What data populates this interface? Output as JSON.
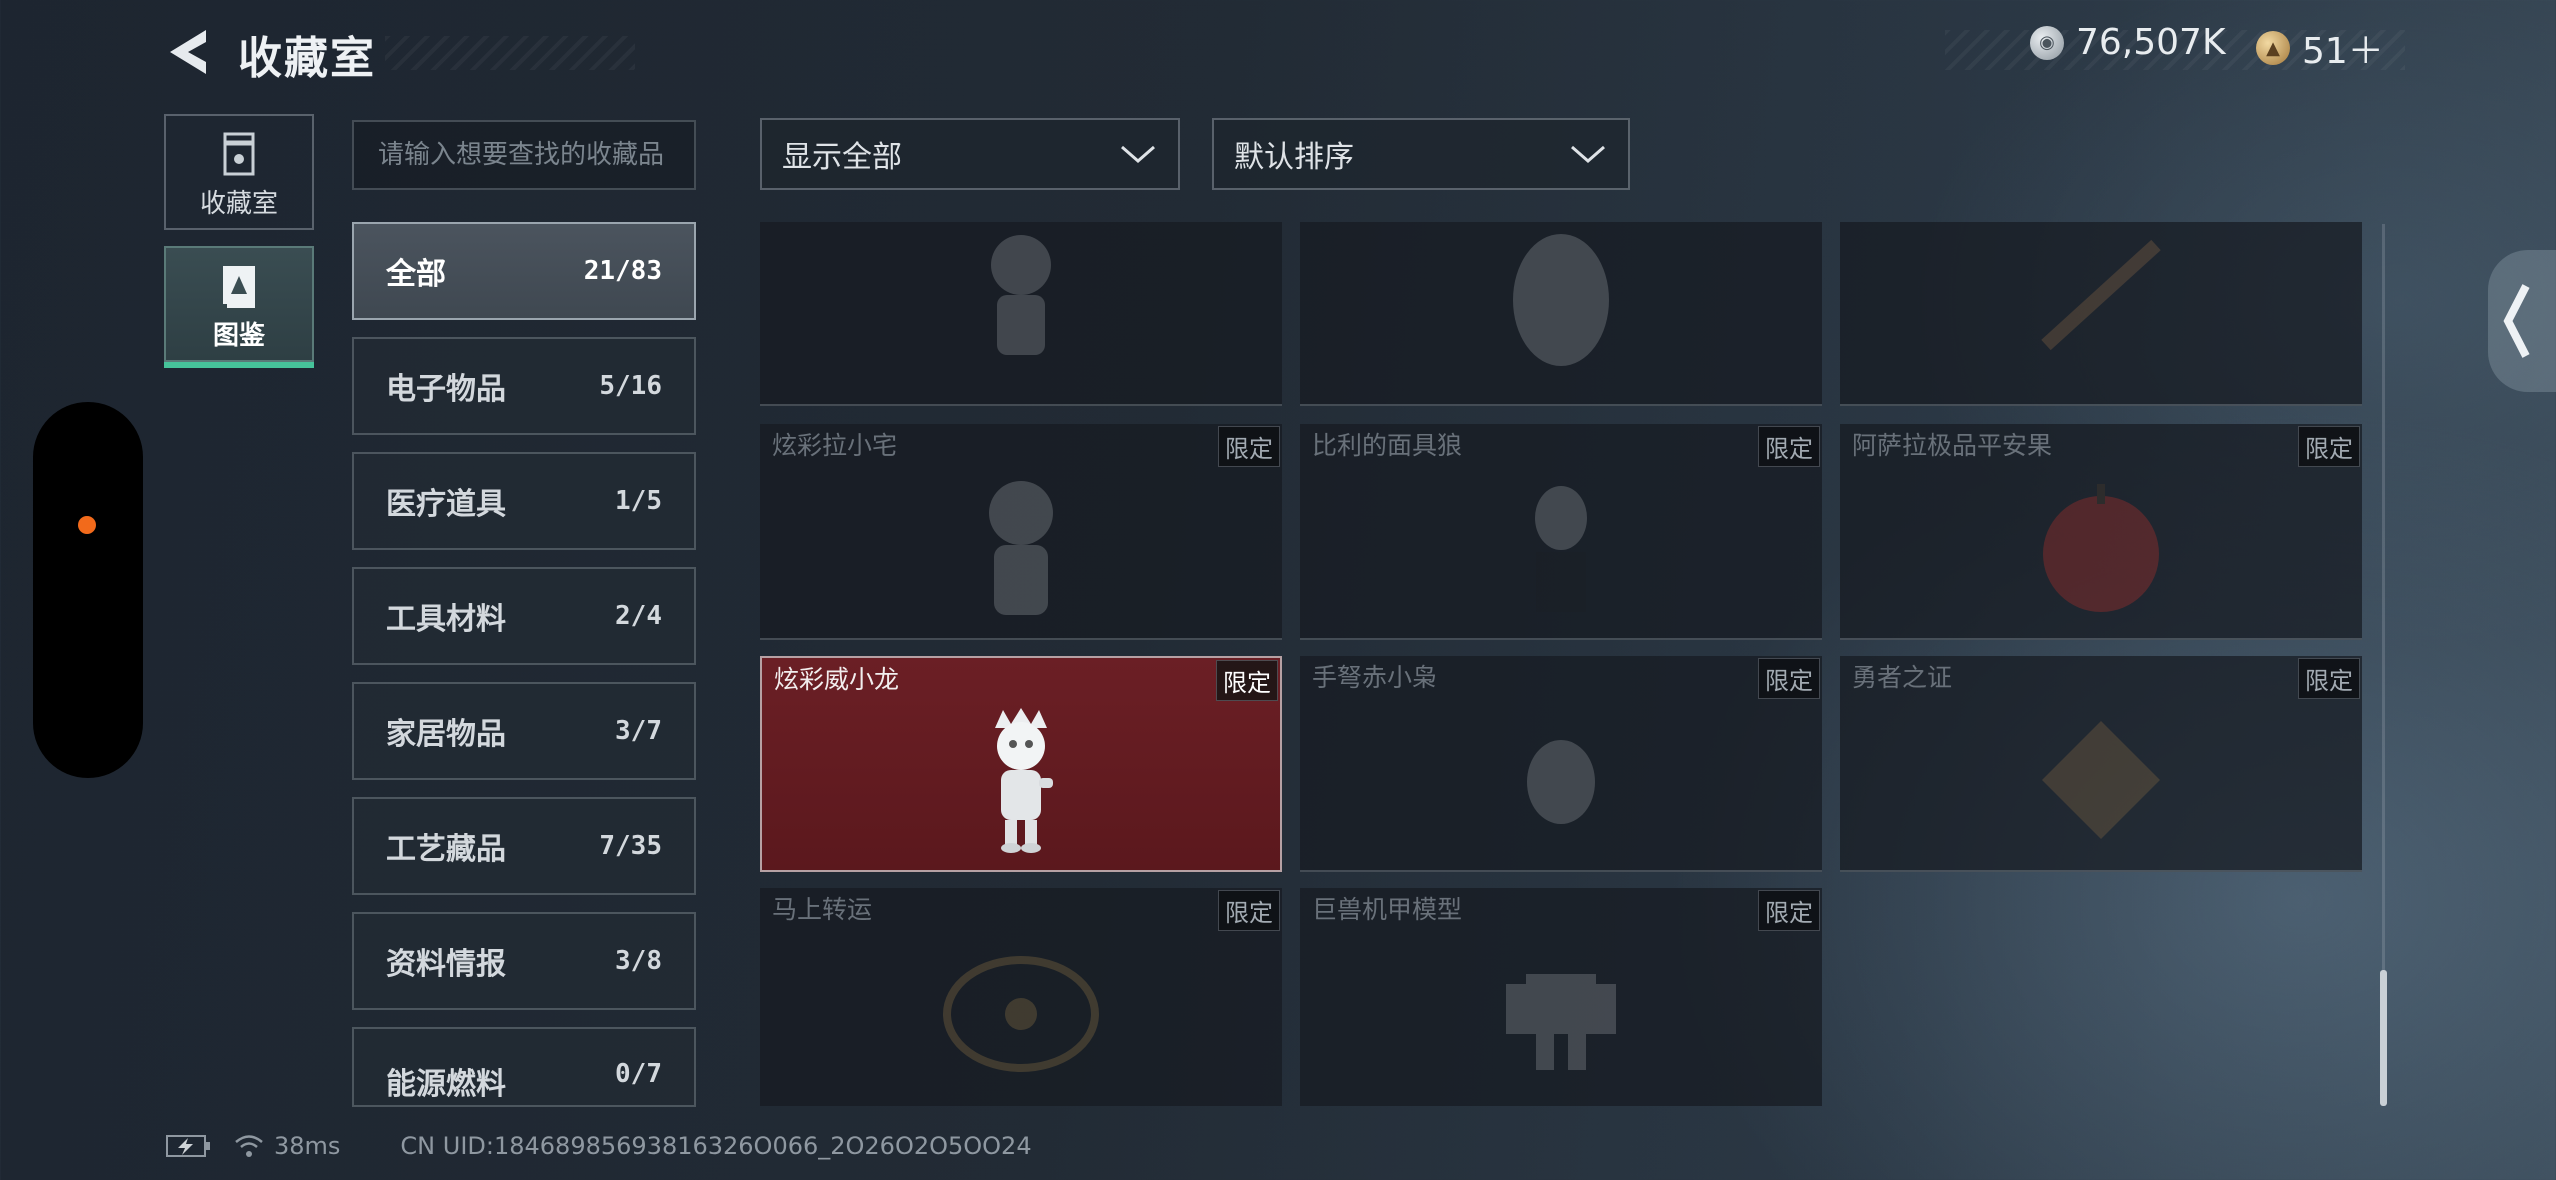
{
  "header": {
    "title": "收藏室",
    "currency": [
      {
        "icon": "silver-coin-icon",
        "value": "76,507K"
      },
      {
        "icon": "gold-coin-icon",
        "value": "51＋"
      }
    ]
  },
  "nav": {
    "collection_label": "收藏室",
    "atlas_label": "图鉴"
  },
  "search": {
    "placeholder": "请输入想要查找的收藏品"
  },
  "categories": [
    {
      "label": "全部",
      "count": "21/83",
      "active": true
    },
    {
      "label": "电子物品",
      "count": "5/16"
    },
    {
      "label": "医疗道具",
      "count": "1/5"
    },
    {
      "label": "工具材料",
      "count": "2/4"
    },
    {
      "label": "家居物品",
      "count": "3/7"
    },
    {
      "label": "工艺藏品",
      "count": "7/35"
    },
    {
      "label": "资料情报",
      "count": "3/8"
    },
    {
      "label": "能源燃料",
      "count": "0/7"
    }
  ],
  "filters": {
    "show_label": "显示全部",
    "sort_label": "默认排序"
  },
  "items": [
    {
      "name": "",
      "tag": "",
      "icon": "figure-icon"
    },
    {
      "name": "",
      "tag": "",
      "icon": "egg-icon"
    },
    {
      "name": "",
      "tag": "",
      "icon": "rod-icon"
    },
    {
      "name": "炫彩拉小宅",
      "tag": "限定",
      "icon": "figure-icon"
    },
    {
      "name": "比利的面具狼",
      "tag": "限定",
      "icon": "mask-icon"
    },
    {
      "name": "阿萨拉极品平安果",
      "tag": "限定",
      "icon": "apple-icon"
    },
    {
      "name": "炫彩威小龙",
      "tag": "限定",
      "icon": "dragon-figure-icon",
      "owned": true
    },
    {
      "name": "手弩赤小枭",
      "tag": "限定",
      "icon": "owl-icon"
    },
    {
      "name": "勇者之证",
      "tag": "限定",
      "icon": "badge-icon"
    },
    {
      "name": "马上转运",
      "tag": "限定",
      "icon": "coin-medal-icon"
    },
    {
      "name": "巨兽机甲模型",
      "tag": "限定",
      "icon": "mech-icon"
    }
  ],
  "status": {
    "ping": "38ms",
    "uid": "CN UID:18468985693816326O066_2O26O2O5OO24"
  },
  "colors": {
    "accent_green": "#46c39a",
    "owned_red": "#6b1f25",
    "status_dot": "#f26a1b"
  }
}
